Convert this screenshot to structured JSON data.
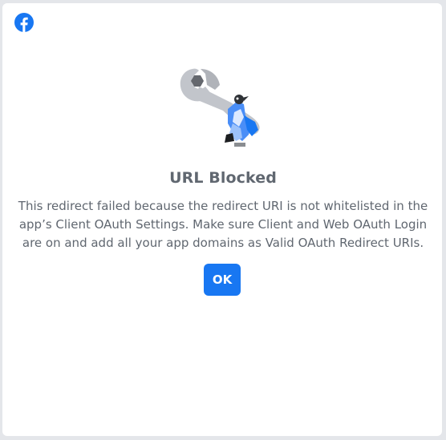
{
  "dialog": {
    "title": "URL Blocked",
    "message": "This redirect failed because the redirect URI is not whitelisted in the app’s Client OAuth Settings. Make sure Client and Web OAuth Login are on and add all your app domains as Valid OAuth Redirect URIs.",
    "ok_label": "OK"
  },
  "icons": {
    "brand": "facebook-logo-icon",
    "illustration": "wrench-with-bird-illustration"
  },
  "colors": {
    "accent": "#1877f2",
    "text": "#606770",
    "background": "#ffffff",
    "page_background": "#e4e6ea"
  }
}
